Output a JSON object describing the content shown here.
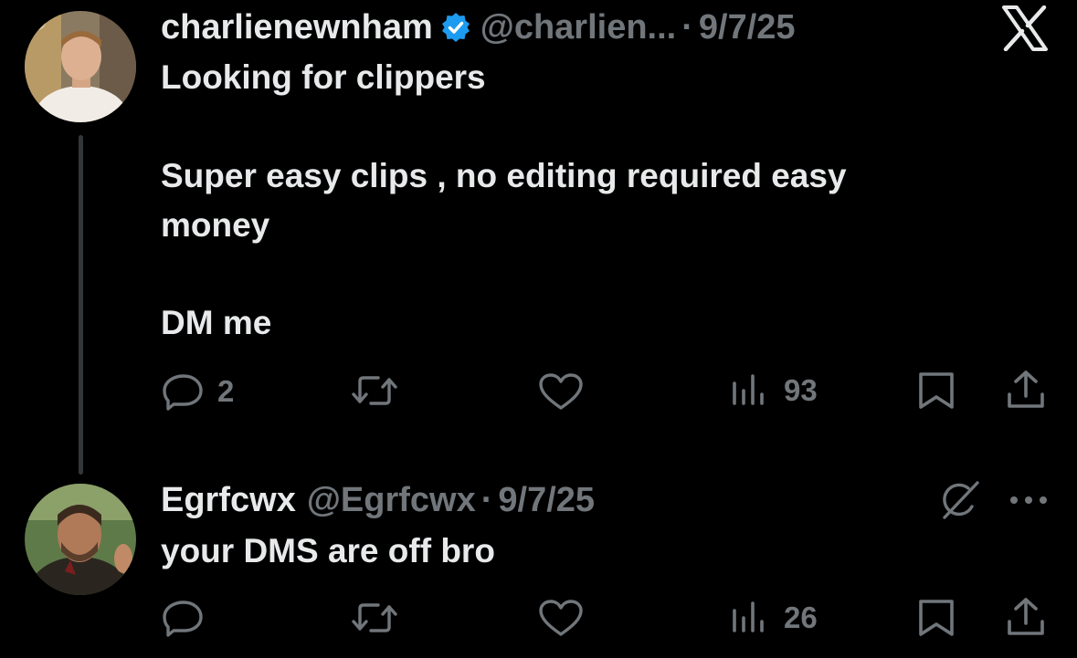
{
  "colors": {
    "background": "#000000",
    "text": "#e7e9ea",
    "muted": "#71767b",
    "verified": "#1d9bf0",
    "thread_line": "#333639"
  },
  "branding": {
    "logo_icon": "x-logo-icon"
  },
  "tweet": {
    "display_name": "charlienewnham",
    "verified_icon": "verified-badge-icon",
    "handle": "@charlien...",
    "separator": "·",
    "date": "9/7/25",
    "lines": [
      "Looking for clippers",
      "Super easy clips , no editing required easy",
      "money",
      "DM me"
    ],
    "actions": {
      "reply_count": "2",
      "retweet_count": "",
      "like_count": "",
      "views_count": "93"
    }
  },
  "reply": {
    "display_name": "Egrfcwx",
    "handle": "@Egrfcwx",
    "separator": "·",
    "date": "9/7/25",
    "lines": [
      "your DMS are off bro"
    ],
    "grok_icon": "grok-icon",
    "more_icon": "more-dots-icon",
    "actions": {
      "reply_count": "",
      "retweet_count": "",
      "like_count": "",
      "views_count": "26"
    }
  }
}
